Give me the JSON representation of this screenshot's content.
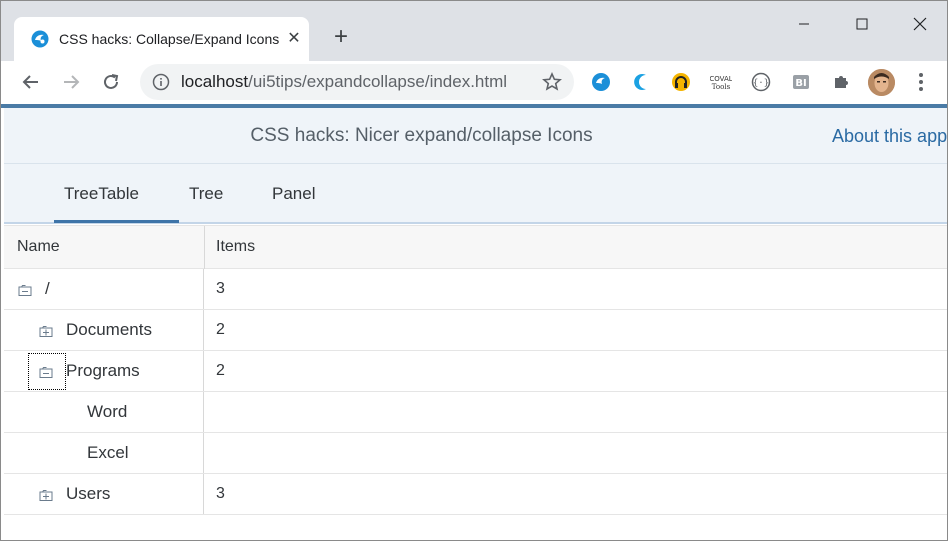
{
  "browser": {
    "tab_title": "CSS hacks: Collapse/Expand Icons",
    "tab_close_label": "✕",
    "new_tab_label": "+",
    "url_host": "localhost",
    "url_path": "/ui5tips/expandcollapse/index.html"
  },
  "app": {
    "title": "CSS hacks: Nicer expand/collapse Icons",
    "about_link": "About this app",
    "accent_color": "#2a6aa3"
  },
  "tabs": [
    {
      "label": "TreeTable",
      "selected": true
    },
    {
      "label": "Tree",
      "selected": false
    },
    {
      "label": "Panel",
      "selected": false
    }
  ],
  "table": {
    "columns": [
      "Name",
      "Items"
    ],
    "rows": [
      {
        "name": "/",
        "items": "3",
        "level": 0,
        "state": "expanded"
      },
      {
        "name": "Documents",
        "items": "2",
        "level": 1,
        "state": "collapsed"
      },
      {
        "name": "Programs",
        "items": "2",
        "level": 1,
        "state": "expanded"
      },
      {
        "name": "Word",
        "items": "",
        "level": 2,
        "state": "leaf"
      },
      {
        "name": "Excel",
        "items": "",
        "level": 2,
        "state": "leaf"
      },
      {
        "name": "Users",
        "items": "3",
        "level": 1,
        "state": "collapsed"
      }
    ]
  }
}
